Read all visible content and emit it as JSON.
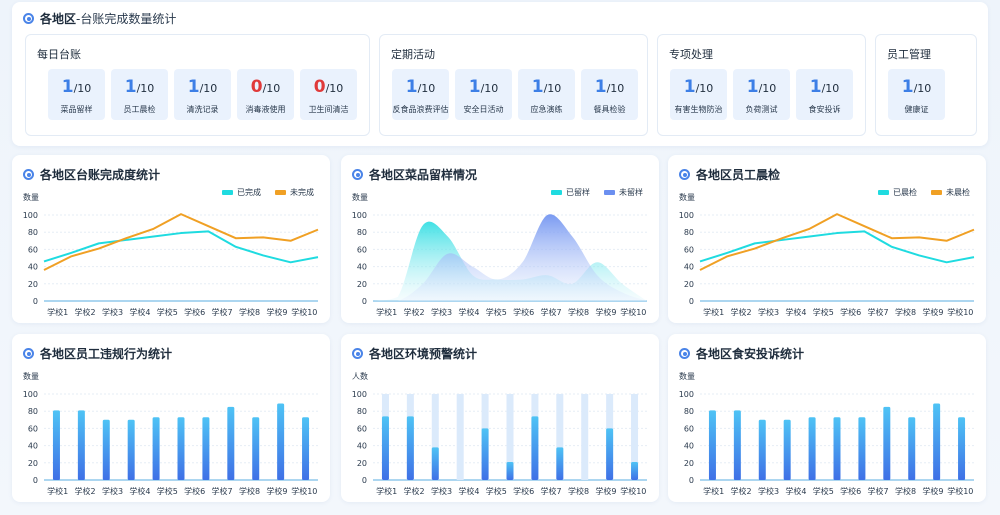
{
  "header": {
    "title_main": "各地区",
    "title_sub": "-台账完成数量统计"
  },
  "groups": [
    {
      "title": "每日台账",
      "items": [
        {
          "done": "1",
          "total": "/10",
          "label": "菜品留样",
          "alert": false
        },
        {
          "done": "1",
          "total": "/10",
          "label": "员工晨检",
          "alert": false
        },
        {
          "done": "1",
          "total": "/10",
          "label": "清洗记录",
          "alert": false
        },
        {
          "done": "0",
          "total": "/10",
          "label": "消毒液使用",
          "alert": true
        },
        {
          "done": "0",
          "total": "/10",
          "label": "卫生间清洁",
          "alert": true
        }
      ]
    },
    {
      "title": "定期活动",
      "items": [
        {
          "done": "1",
          "total": "/10",
          "label": "反食品浪费评估",
          "alert": false
        },
        {
          "done": "1",
          "total": "/10",
          "label": "安全日活动",
          "alert": false
        },
        {
          "done": "1",
          "total": "/10",
          "label": "应急演练",
          "alert": false
        },
        {
          "done": "1",
          "total": "/10",
          "label": "餐具检验",
          "alert": false
        }
      ]
    },
    {
      "title": "专项处理",
      "items": [
        {
          "done": "1",
          "total": "/10",
          "label": "有害生物防治",
          "alert": false
        },
        {
          "done": "1",
          "total": "/10",
          "label": "负荷测试",
          "alert": false
        },
        {
          "done": "1",
          "total": "/10",
          "label": "食安投诉",
          "alert": false
        }
      ]
    },
    {
      "title": "员工管理",
      "items": [
        {
          "done": "1",
          "total": "/10",
          "label": "健康证",
          "alert": false
        }
      ]
    }
  ],
  "colors": {
    "accent": "#4a84e8",
    "cyan": "#1fdbe0",
    "orange": "#f0a024",
    "blue_area": "#6b8ff0",
    "alert_red": "#e03a3a",
    "bar_bg": "#dbeafb"
  },
  "chart_data": [
    {
      "type": "line",
      "title": "各地区台账完成度统计",
      "ylabel": "数量",
      "categories": [
        "学校1",
        "学校2",
        "学校3",
        "学校4",
        "学校5",
        "学校6",
        "学校7",
        "学校8",
        "学校9",
        "学校10"
      ],
      "yticks": [
        0,
        20,
        40,
        60,
        80,
        100
      ],
      "ylim": [
        0,
        100
      ],
      "series": [
        {
          "name": "已完成",
          "color": "#1fdbe0",
          "values": [
            46,
            56,
            67,
            71,
            75,
            79,
            81,
            63,
            53,
            45,
            51
          ]
        },
        {
          "name": "未完成",
          "color": "#f0a024",
          "values": [
            36,
            52,
            61,
            73,
            84,
            101,
            87,
            73,
            74,
            70,
            83
          ]
        }
      ],
      "legend": "top-right"
    },
    {
      "type": "area",
      "title": "各地区菜品留样情况",
      "ylabel": "数量",
      "categories": [
        "学校1",
        "学校2",
        "学校3",
        "学校4",
        "学校5",
        "学校6",
        "学校7",
        "学校8",
        "学校9",
        "学校10"
      ],
      "yticks": [
        0,
        20,
        40,
        60,
        80,
        100
      ],
      "ylim": [
        0,
        100
      ],
      "series": [
        {
          "name": "已留样",
          "color": "#1fdbe0",
          "values": [
            0,
            5,
            88,
            75,
            30,
            25,
            25,
            30,
            20,
            45,
            20,
            0
          ]
        },
        {
          "name": "未留样",
          "color": "#6b8ff0",
          "values": [
            0,
            0,
            20,
            55,
            40,
            25,
            45,
            100,
            75,
            30,
            10,
            0
          ]
        }
      ],
      "legend": "top-right"
    },
    {
      "type": "line",
      "title": "各地区员工晨检",
      "ylabel": "数量",
      "categories": [
        "学校1",
        "学校2",
        "学校3",
        "学校4",
        "学校5",
        "学校6",
        "学校7",
        "学校8",
        "学校9",
        "学校10"
      ],
      "yticks": [
        0,
        20,
        40,
        60,
        80,
        100
      ],
      "ylim": [
        0,
        100
      ],
      "series": [
        {
          "name": "已晨检",
          "color": "#1fdbe0",
          "values": [
            46,
            56,
            67,
            71,
            75,
            79,
            81,
            63,
            53,
            45,
            51
          ]
        },
        {
          "name": "未晨检",
          "color": "#f0a024",
          "values": [
            36,
            52,
            61,
            73,
            84,
            101,
            87,
            73,
            74,
            70,
            83
          ]
        }
      ],
      "legend": "top-right"
    },
    {
      "type": "bar",
      "title": "各地区员工违规行为统计",
      "ylabel": "数量",
      "categories": [
        "学校1",
        "学校2",
        "学校3",
        "学校4",
        "学校5",
        "学校6",
        "学校7",
        "学校8",
        "学校9",
        "学校10"
      ],
      "yticks": [
        0,
        20,
        40,
        60,
        80,
        100
      ],
      "ylim": [
        0,
        100
      ],
      "values": [
        81,
        81,
        70,
        70,
        73,
        73,
        73,
        85,
        73,
        89,
        73
      ],
      "background_bars": false
    },
    {
      "type": "bar",
      "title": "各地区环境预警统计",
      "ylabel": "人数",
      "categories": [
        "学校1",
        "学校2",
        "学校3",
        "学校4",
        "学校5",
        "学校6",
        "学校7",
        "学校8",
        "学校9",
        "学校10"
      ],
      "yticks": [
        0,
        20,
        40,
        60,
        80,
        100
      ],
      "ylim": [
        0,
        100
      ],
      "values": [
        74,
        74,
        38,
        0,
        60,
        21,
        74,
        38,
        0,
        60,
        21
      ],
      "background_bars": true
    },
    {
      "type": "bar",
      "title": "各地区食安投诉统计",
      "ylabel": "数量",
      "categories": [
        "学校1",
        "学校2",
        "学校3",
        "学校4",
        "学校5",
        "学校6",
        "学校7",
        "学校8",
        "学校9",
        "学校10"
      ],
      "yticks": [
        0,
        20,
        40,
        60,
        80,
        100
      ],
      "ylim": [
        0,
        100
      ],
      "values": [
        81,
        81,
        70,
        70,
        73,
        73,
        73,
        85,
        73,
        89,
        73
      ],
      "background_bars": false
    }
  ]
}
